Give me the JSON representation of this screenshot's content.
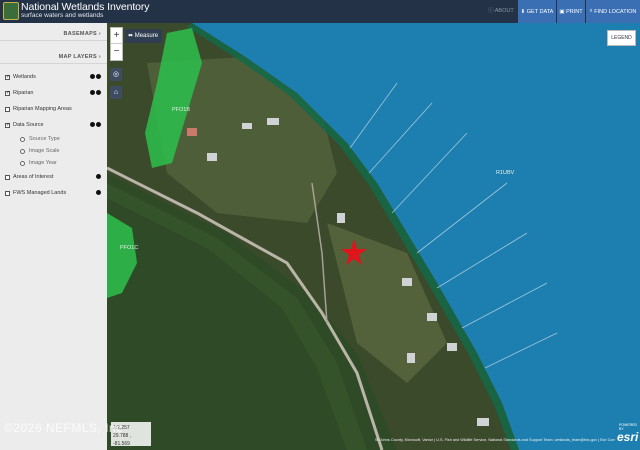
{
  "header": {
    "title": "National Wetlands Inventory",
    "subtitle": "surface waters and wetlands",
    "about": "ABOUT",
    "get_data": "GET DATA",
    "print": "PRINT",
    "find_location": "FIND LOCATION"
  },
  "sidebar": {
    "basemaps": "BASEMAPS",
    "map_layers": "MAP LAYERS",
    "layers": {
      "wetlands": {
        "label": "Wetlands",
        "checked": true
      },
      "riparian": {
        "label": "Riparian",
        "checked": true
      },
      "riparian_mapping": {
        "label": "Riparian Mapping Areas",
        "checked": false
      },
      "data_source": {
        "label": "Data Source",
        "checked": true
      },
      "source_type": "Source Type",
      "image_scale": "Image Scale",
      "image_year": "Image Year",
      "areas_of_interest": {
        "label": "Areas of Interest",
        "checked": false
      },
      "fws_managed": {
        "label": "FWS Managed Lands",
        "checked": false
      }
    }
  },
  "map": {
    "measure": "Measure",
    "legend": "LEGEND",
    "labels": {
      "pfo1b": "PFO1B",
      "pfo1c": "PFO1C",
      "r1ubv": "R1UBV"
    },
    "coords": {
      "scale": "1:2,257",
      "latlon": "29.788 , -81.569"
    },
    "attribution": "St Johns County, Microsoft, Vantor | U.S. Fish and Wildlife Service, National Standards and Support Team, wetlands_team@fws.gov | Esri Com...",
    "powered_by": "POWERED BY",
    "esri": "esri"
  },
  "watermark": "©2026 NEFMLS, Inc",
  "colors": {
    "header_bg": "#243247",
    "button_blue": "#3b6fb3",
    "water": "#1d7fb0",
    "wetland_green": "#2dbf4d",
    "marker_red": "#e0141b"
  }
}
